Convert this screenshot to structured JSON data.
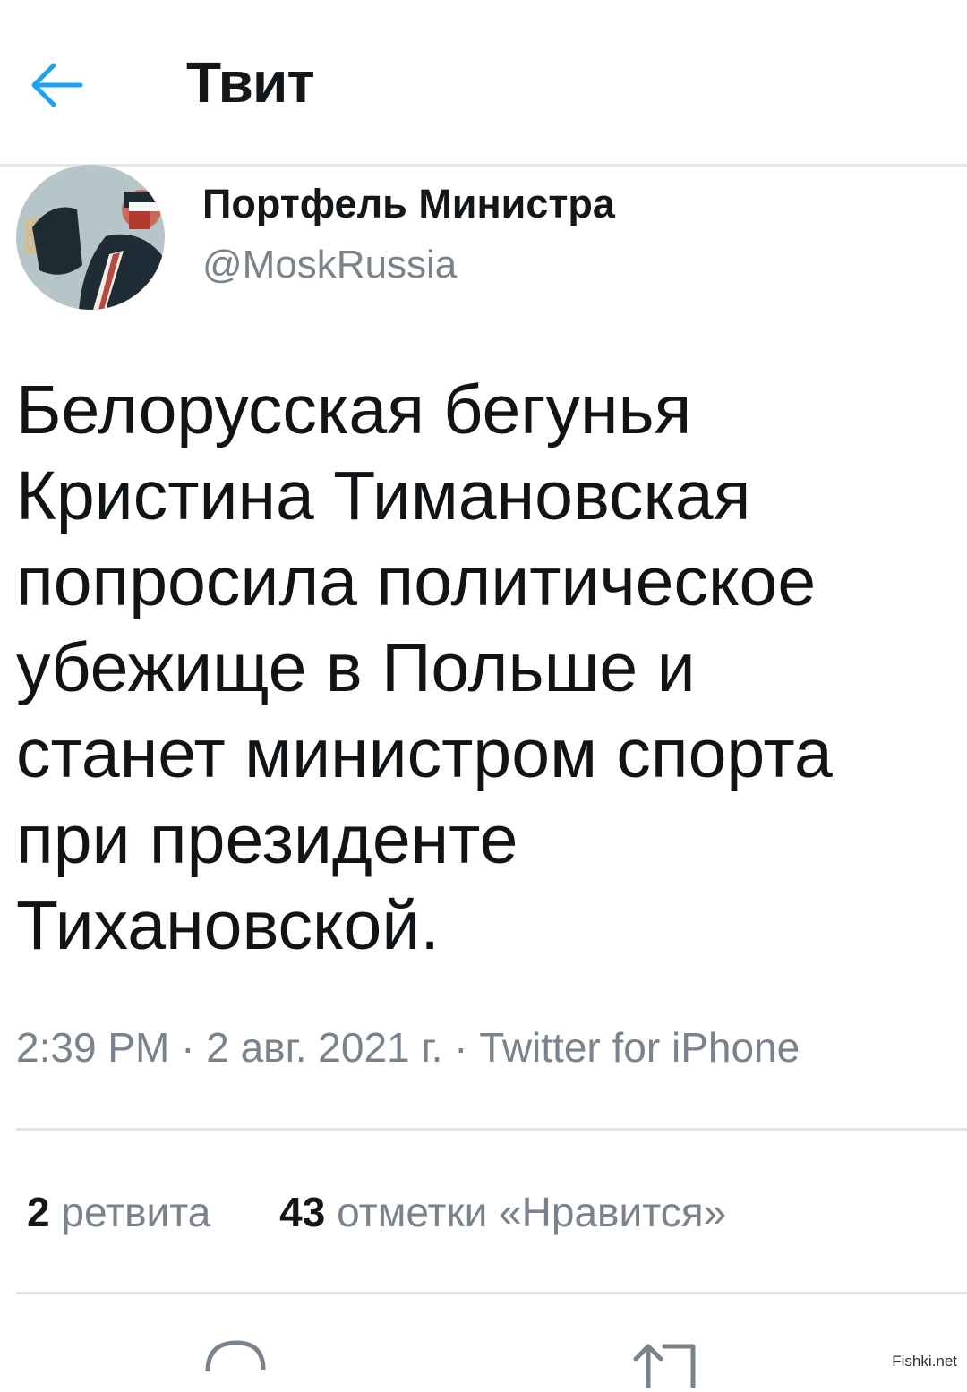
{
  "header": {
    "title": "Твит",
    "back_icon": "arrow-left-icon"
  },
  "tweet": {
    "author_name": "Портфель Министра",
    "author_handle": "@MoskRussia",
    "text": "Белорусская бегунья\nКристина Тимановская\nпопросила политическое\nубежище в Польше и\nстанет министром спорта\nпри президенте\nТихановской.",
    "time": "2:39 PM",
    "date": "2 авг. 2021 г.",
    "source": "Twitter for iPhone",
    "separator": "·"
  },
  "stats": {
    "retweets_count": "2",
    "retweets_label": "ретвита",
    "likes_count": "43",
    "likes_label": "отметки «Нравится»"
  },
  "actions": {
    "reply_icon": "reply-icon",
    "retweet_icon": "retweet-icon"
  },
  "watermark": "Fishki.net",
  "colors": {
    "accent": "#1da1f2",
    "secondary_text": "#7a838c",
    "divider": "#e3e6e9",
    "primary_text": "#14171a"
  }
}
